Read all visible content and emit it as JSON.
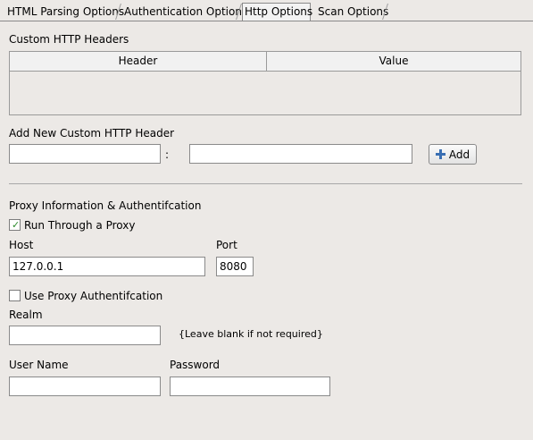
{
  "tabs": [
    {
      "label": "HTML Parsing Options"
    },
    {
      "label": "Authentication Options"
    },
    {
      "label": "Http Options",
      "active": true
    },
    {
      "label": "Scan Options"
    }
  ],
  "custom_headers": {
    "section_label": "Custom HTTP Headers",
    "columns": [
      "Header",
      "Value"
    ],
    "rows": []
  },
  "add_header": {
    "section_label": "Add New Custom HTTP Header",
    "name_value": "",
    "separator": ":",
    "value_value": "",
    "add_label": "Add"
  },
  "proxy": {
    "section_label": "Proxy Information & Authentifcation",
    "run_through_label": "Run Through a Proxy",
    "run_through_checked": true,
    "host_label": "Host",
    "host_value": "127.0.0.1",
    "port_label": "Port",
    "port_value": "8080",
    "use_auth_label": "Use Proxy Authentifcation",
    "use_auth_checked": false,
    "realm_label": "Realm",
    "realm_value": "",
    "realm_hint": "{Leave blank if not required}",
    "username_label": "User Name",
    "username_value": "",
    "password_label": "Password",
    "password_value": ""
  },
  "colors": {
    "background": "#ece9e6",
    "checkmark": "#2c8a2c",
    "add_icon": "#3a6fb3"
  },
  "icons": {
    "add": "plus-icon",
    "check": "checkmark-icon"
  }
}
